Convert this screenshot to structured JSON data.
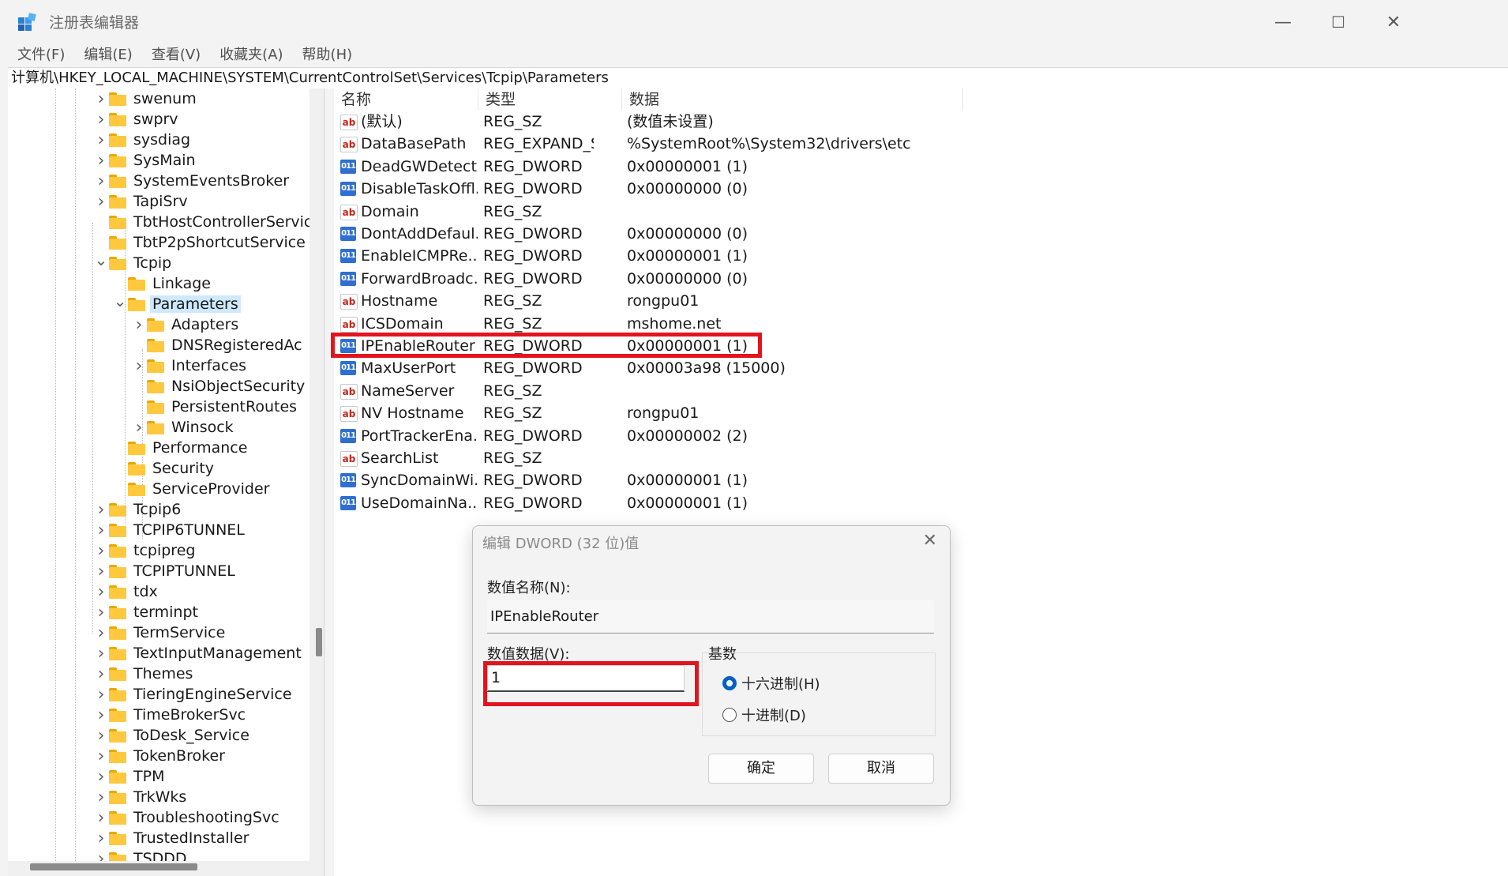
{
  "window": {
    "title": "注册表编辑器",
    "minimize": "—",
    "maximize": "☐",
    "close": "✕"
  },
  "menu": [
    "文件(F)",
    "编辑(E)",
    "查看(V)",
    "收藏夹(A)",
    "帮助(H)"
  ],
  "address": "计算机\\HKEY_LOCAL_MACHINE\\SYSTEM\\CurrentControlSet\\Services\\Tcpip\\Parameters",
  "tree": [
    {
      "label": "swenum",
      "depth": 0,
      "expander": "closed"
    },
    {
      "label": "swprv",
      "depth": 0,
      "expander": "closed"
    },
    {
      "label": "sysdiag",
      "depth": 0,
      "expander": "closed"
    },
    {
      "label": "SysMain",
      "depth": 0,
      "expander": "closed"
    },
    {
      "label": "SystemEventsBroker",
      "depth": 0,
      "expander": "closed"
    },
    {
      "label": "TapiSrv",
      "depth": 0,
      "expander": "closed"
    },
    {
      "label": "TbtHostControllerServic",
      "depth": 0,
      "expander": "none"
    },
    {
      "label": "TbtP2pShortcutService",
      "depth": 0,
      "expander": "none"
    },
    {
      "label": "Tcpip",
      "depth": 0,
      "expander": "open"
    },
    {
      "label": "Linkage",
      "depth": 1,
      "expander": "none"
    },
    {
      "label": "Parameters",
      "depth": 1,
      "expander": "open",
      "selected": true
    },
    {
      "label": "Adapters",
      "depth": 2,
      "expander": "closed"
    },
    {
      "label": "DNSRegisteredAc",
      "depth": 2,
      "expander": "none"
    },
    {
      "label": "Interfaces",
      "depth": 2,
      "expander": "closed"
    },
    {
      "label": "NsiObjectSecurity",
      "depth": 2,
      "expander": "none"
    },
    {
      "label": "PersistentRoutes",
      "depth": 2,
      "expander": "none"
    },
    {
      "label": "Winsock",
      "depth": 2,
      "expander": "closed"
    },
    {
      "label": "Performance",
      "depth": 1,
      "expander": "none"
    },
    {
      "label": "Security",
      "depth": 1,
      "expander": "none"
    },
    {
      "label": "ServiceProvider",
      "depth": 1,
      "expander": "none"
    },
    {
      "label": "Tcpip6",
      "depth": 0,
      "expander": "closed"
    },
    {
      "label": "TCPIP6TUNNEL",
      "depth": 0,
      "expander": "closed"
    },
    {
      "label": "tcpipreg",
      "depth": 0,
      "expander": "closed"
    },
    {
      "label": "TCPIPTUNNEL",
      "depth": 0,
      "expander": "closed"
    },
    {
      "label": "tdx",
      "depth": 0,
      "expander": "closed"
    },
    {
      "label": "terminpt",
      "depth": 0,
      "expander": "closed"
    },
    {
      "label": "TermService",
      "depth": 0,
      "expander": "closed"
    },
    {
      "label": "TextInputManagement",
      "depth": 0,
      "expander": "closed"
    },
    {
      "label": "Themes",
      "depth": 0,
      "expander": "closed"
    },
    {
      "label": "TieringEngineService",
      "depth": 0,
      "expander": "closed"
    },
    {
      "label": "TimeBrokerSvc",
      "depth": 0,
      "expander": "closed"
    },
    {
      "label": "ToDesk_Service",
      "depth": 0,
      "expander": "closed"
    },
    {
      "label": "TokenBroker",
      "depth": 0,
      "expander": "closed"
    },
    {
      "label": "TPM",
      "depth": 0,
      "expander": "closed"
    },
    {
      "label": "TrkWks",
      "depth": 0,
      "expander": "closed"
    },
    {
      "label": "TroubleshootingSvc",
      "depth": 0,
      "expander": "closed"
    },
    {
      "label": "TrustedInstaller",
      "depth": 0,
      "expander": "closed"
    },
    {
      "label": "TSDDD",
      "depth": 0,
      "expander": "closed"
    }
  ],
  "list": {
    "columns": [
      "名称",
      "类型",
      "数据"
    ],
    "rows": [
      {
        "icon": "ab",
        "name": "(默认)",
        "type": "REG_SZ",
        "data": "(数值未设置)"
      },
      {
        "icon": "ab",
        "name": "DataBasePath",
        "type": "REG_EXPAND_SZ",
        "data": "%SystemRoot%\\System32\\drivers\\etc"
      },
      {
        "icon": "bin",
        "name": "DeadGWDetect...",
        "type": "REG_DWORD",
        "data": "0x00000001 (1)"
      },
      {
        "icon": "bin",
        "name": "DisableTaskOffl...",
        "type": "REG_DWORD",
        "data": "0x00000000 (0)"
      },
      {
        "icon": "ab",
        "name": "Domain",
        "type": "REG_SZ",
        "data": ""
      },
      {
        "icon": "bin",
        "name": "DontAddDefaul...",
        "type": "REG_DWORD",
        "data": "0x00000000 (0)"
      },
      {
        "icon": "bin",
        "name": "EnableICMPRe...",
        "type": "REG_DWORD",
        "data": "0x00000001 (1)"
      },
      {
        "icon": "bin",
        "name": "ForwardBroadc...",
        "type": "REG_DWORD",
        "data": "0x00000000 (0)"
      },
      {
        "icon": "ab",
        "name": "Hostname",
        "type": "REG_SZ",
        "data": "rongpu01"
      },
      {
        "icon": "ab",
        "name": "ICSDomain",
        "type": "REG_SZ",
        "data": "mshome.net"
      },
      {
        "icon": "bin",
        "name": "IPEnableRouter",
        "type": "REG_DWORD",
        "data": "0x00000001 (1)"
      },
      {
        "icon": "bin",
        "name": "MaxUserPort",
        "type": "REG_DWORD",
        "data": "0x00003a98 (15000)"
      },
      {
        "icon": "ab",
        "name": "NameServer",
        "type": "REG_SZ",
        "data": ""
      },
      {
        "icon": "ab",
        "name": "NV Hostname",
        "type": "REG_SZ",
        "data": "rongpu01"
      },
      {
        "icon": "bin",
        "name": "PortTrackerEna...",
        "type": "REG_DWORD",
        "data": "0x00000002 (2)"
      },
      {
        "icon": "ab",
        "name": "SearchList",
        "type": "REG_SZ",
        "data": ""
      },
      {
        "icon": "bin",
        "name": "SyncDomainWi...",
        "type": "REG_DWORD",
        "data": "0x00000001 (1)"
      },
      {
        "icon": "bin",
        "name": "UseDomainNa...",
        "type": "REG_DWORD",
        "data": "0x00000001 (1)"
      }
    ]
  },
  "icon_text": {
    "ab": "ab",
    "bin": "011"
  },
  "dialog": {
    "title": "编辑 DWORD (32 位)值",
    "close": "✕",
    "name_label": "数值名称(N):",
    "name_value": "IPEnableRouter",
    "data_label": "数值数据(V):",
    "data_value": "1",
    "base_label": "基数",
    "hex_label": "十六进制(H)",
    "dec_label": "十进制(D)",
    "ok": "确定",
    "cancel": "取消"
  },
  "highlight_color": "#e3141e"
}
